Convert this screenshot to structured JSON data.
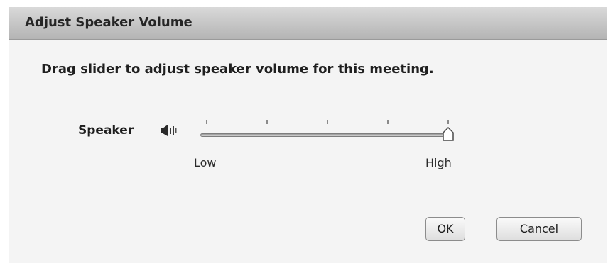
{
  "dialog": {
    "title": "Adjust Speaker Volume",
    "instruction": "Drag slider to adjust speaker volume for this meeting."
  },
  "speaker": {
    "label": "Speaker",
    "icon": "speaker-volume-icon",
    "slider": {
      "value_fraction": 1.0,
      "tick_count": 5,
      "min_label": "Low",
      "max_label": "High"
    }
  },
  "buttons": {
    "ok_label": "OK",
    "cancel_label": "Cancel"
  },
  "colors": {
    "dialog_background": "#f4f4f4",
    "titlebar": "#c4c4c4"
  }
}
